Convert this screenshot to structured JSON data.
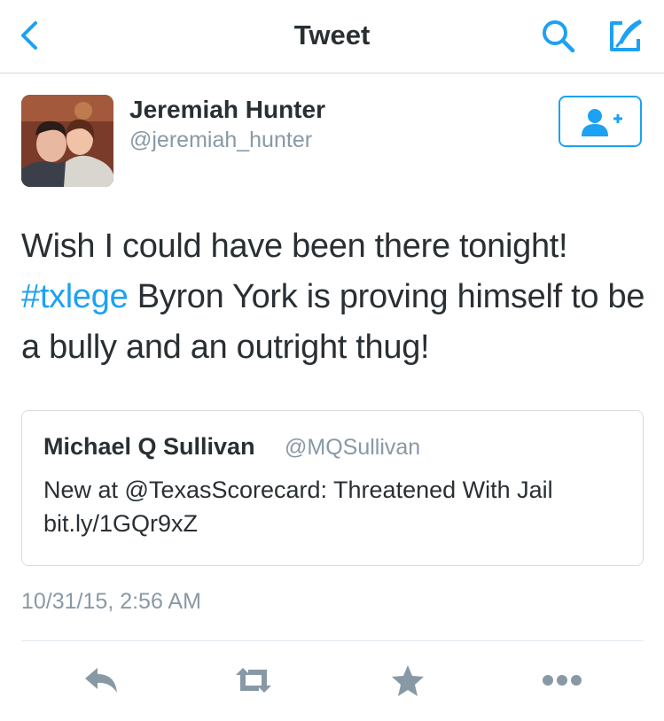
{
  "header": {
    "title": "Tweet",
    "back_icon": "chevron-left-icon",
    "search_icon": "search-icon",
    "compose_icon": "compose-icon"
  },
  "tweet": {
    "author_name": "Jeremiah Hunter",
    "author_handle": "@jeremiah_hunter",
    "follow_icon": "add-user-icon",
    "text_before": "Wish I could have been there tonight! ",
    "hashtag": "#txlege",
    "text_after": " Byron York is proving himself to be a bully and an outright thug!",
    "timestamp": "10/31/15, 2:56 AM"
  },
  "quoted_tweet": {
    "author_name": "Michael Q Sullivan",
    "author_handle": "@MQSullivan",
    "text": "New at @TexasScorecard: Threatened With Jail bit.ly/1GQr9xZ"
  },
  "actions": [
    {
      "name": "reply",
      "icon": "reply-icon"
    },
    {
      "name": "retweet",
      "icon": "retweet-icon"
    },
    {
      "name": "favorite",
      "icon": "star-icon"
    },
    {
      "name": "more",
      "icon": "more-icon"
    }
  ],
  "colors": {
    "accent": "#1da1f2",
    "text": "#292f33",
    "secondary": "#8899a6",
    "action_icon": "#8899a6",
    "border": "#d8dde1"
  }
}
